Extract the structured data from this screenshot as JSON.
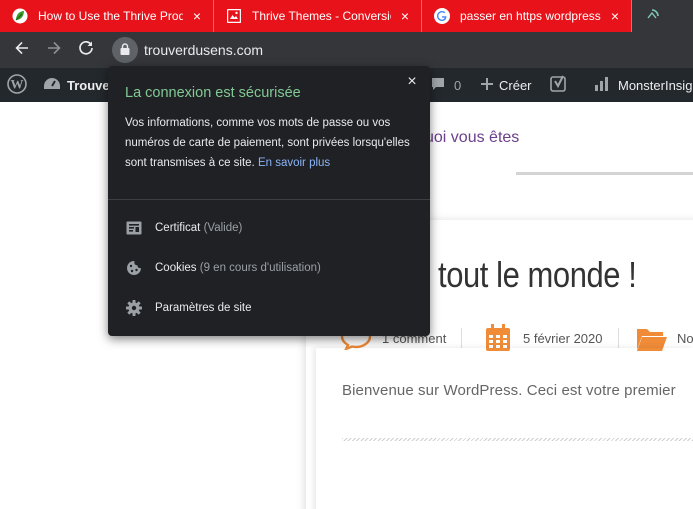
{
  "browser": {
    "tabs": [
      {
        "title": "How to Use the Thrive Prod",
        "favicon": "leaf-icon",
        "active": false
      },
      {
        "title": "Thrive Themes - Conversion",
        "favicon": "thrive-icon",
        "active": false
      },
      {
        "title": "passer en https wordpress -",
        "favicon": "google-icon",
        "active": false
      },
      {
        "title": "",
        "favicon": "loading-icon",
        "active": true
      }
    ],
    "tab_close_glyph": "×",
    "address": "trouverdusens.com",
    "accent_color": "#e8131a"
  },
  "adminbar": {
    "site_name": "Trouver",
    "comments_count": "0",
    "new_label": "Créer",
    "monsterinsights_label": "MonsterInsig"
  },
  "page": {
    "tagline": "uoi vous êtes",
    "post_title": "r tout le monde !",
    "comments_meta": "1 comment",
    "date_meta": "5 février 2020",
    "category_meta": "No",
    "excerpt": "Bienvenue sur WordPress. Ceci est votre premier"
  },
  "popup": {
    "close_glyph": "×",
    "title": "La connexion est sécurisée",
    "description": "Vos informations, comme vos mots de passe ou vos numéros de carte de paiement, sont privées lorsqu'elles sont transmises à ce site.",
    "learn_more": "En savoir plus",
    "rows": [
      {
        "label": "Certificat",
        "sub": "(Valide)",
        "icon": "certificate-icon"
      },
      {
        "label": "Cookies",
        "sub": "(9 en cours d'utilisation)",
        "icon": "cookie-icon"
      },
      {
        "label": "Paramètres de site",
        "sub": "",
        "icon": "gear-icon"
      }
    ]
  }
}
